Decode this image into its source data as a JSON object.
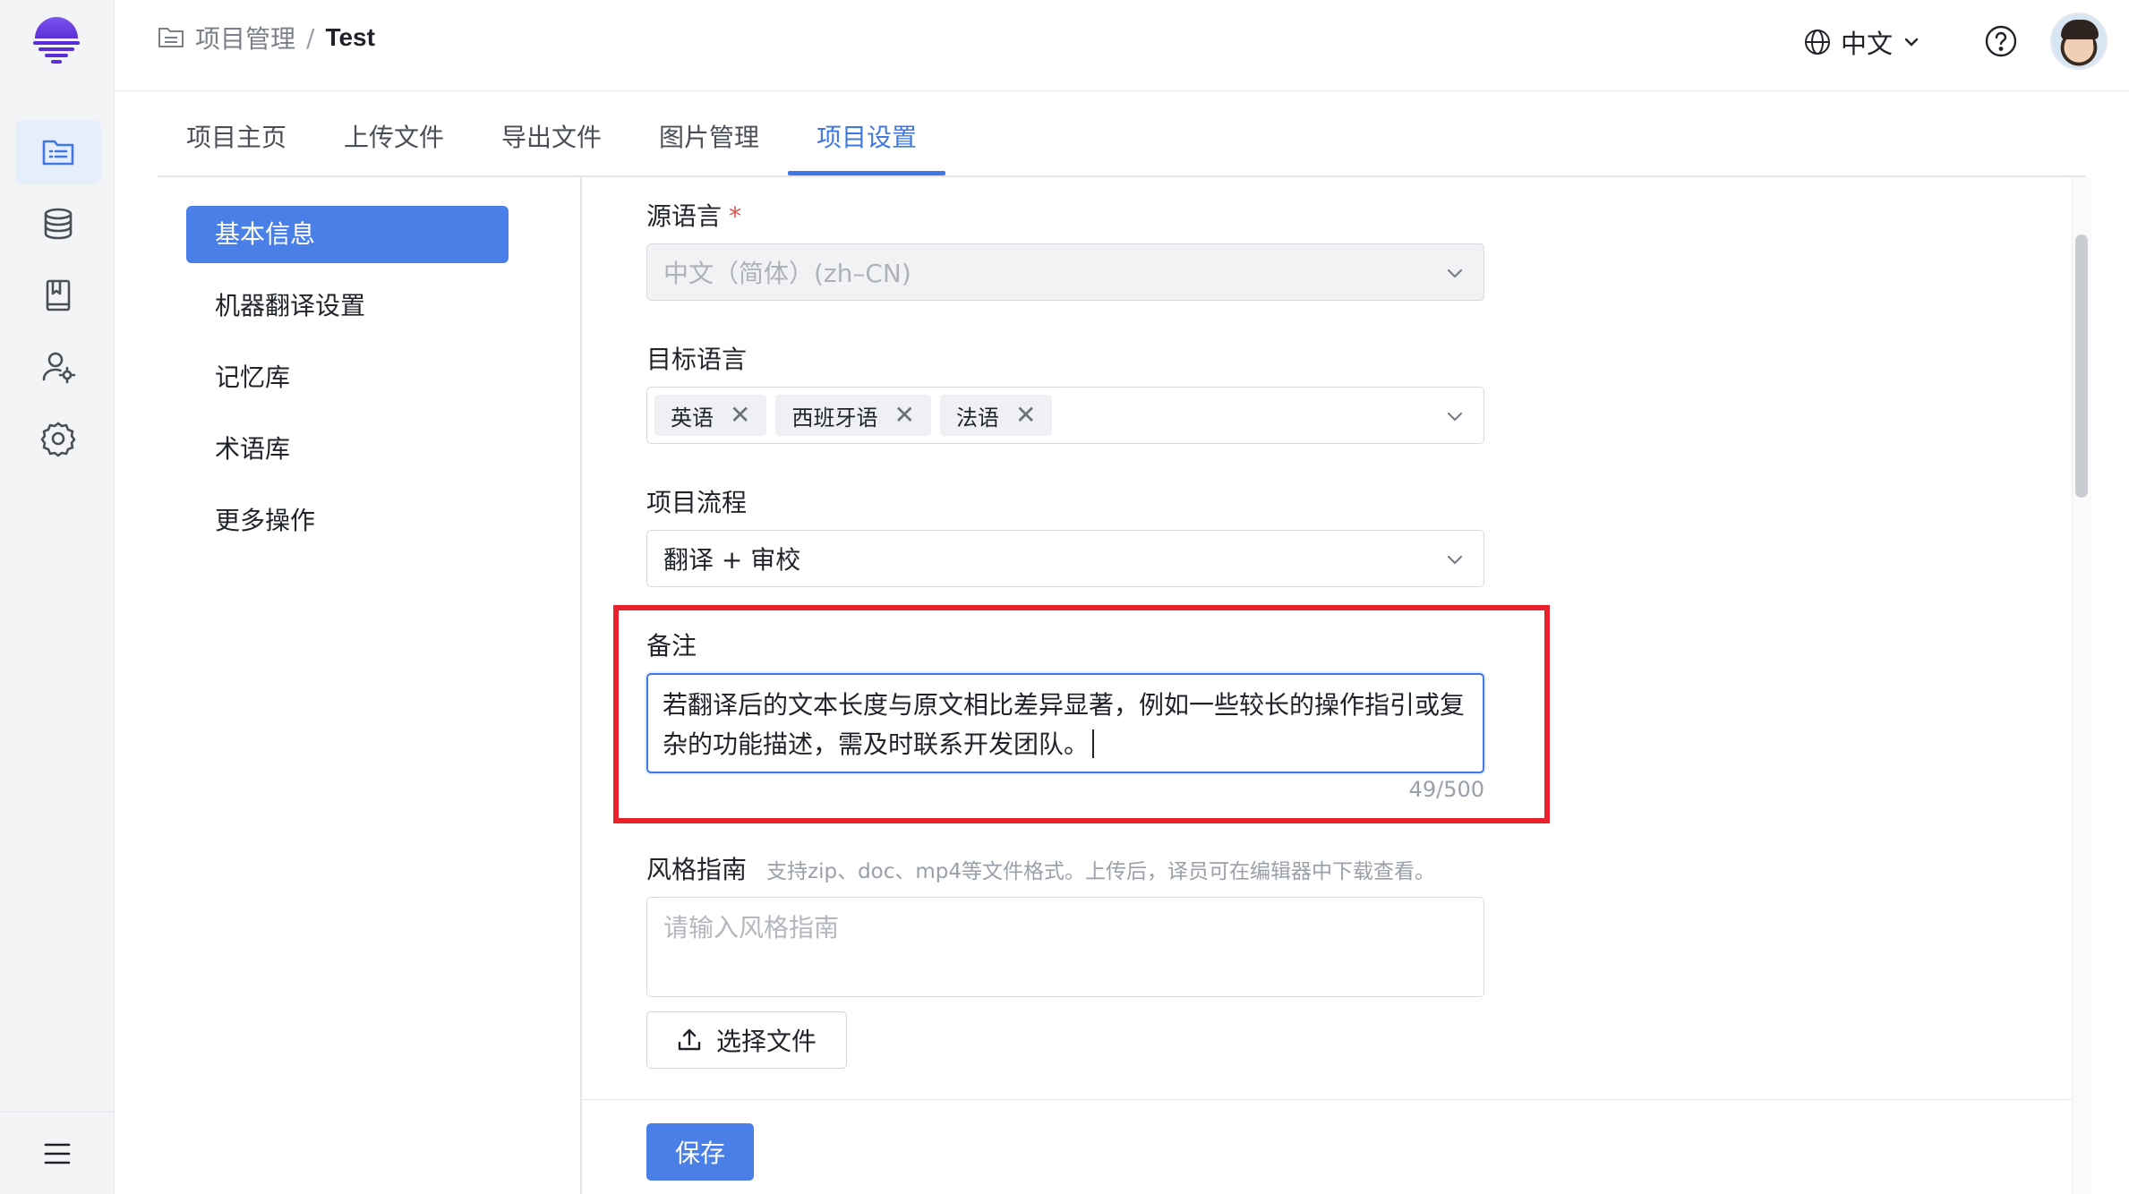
{
  "header": {
    "breadcrumb_parent": "项目管理",
    "breadcrumb_sep": "/",
    "breadcrumb_current": "Test",
    "language": "中文"
  },
  "tabs": [
    {
      "label": "项目主页"
    },
    {
      "label": "上传文件"
    },
    {
      "label": "导出文件"
    },
    {
      "label": "图片管理"
    },
    {
      "label": "项目设置",
      "active": true
    }
  ],
  "subnav": [
    {
      "label": "基本信息",
      "active": true
    },
    {
      "label": "机器翻译设置"
    },
    {
      "label": "记忆库"
    },
    {
      "label": "术语库"
    },
    {
      "label": "更多操作"
    }
  ],
  "form": {
    "source_language": {
      "label": "源语言",
      "required_mark": "*",
      "value": "中文（简体）(zh–CN)"
    },
    "target_language": {
      "label": "目标语言",
      "tags": [
        "英语",
        "西班牙语",
        "法语"
      ],
      "tag_remove": "✕"
    },
    "workflow": {
      "label": "项目流程",
      "value": "翻译 + 审校"
    },
    "notes": {
      "label": "备注",
      "value_line1": "若翻译后的文本长度与原文相比差异显著，例如一些较长的操作指引或复",
      "value_line2": "杂的功能描述，需及时联系开发团队。",
      "counter": "49/500"
    },
    "style_guide": {
      "label": "风格指南",
      "hint": "支持zip、doc、mp4等文件格式。上传后，译员可在编辑器中下载查看。",
      "placeholder": "请输入风格指南",
      "upload_label": "选择文件"
    }
  },
  "footer": {
    "save_label": "保存"
  },
  "colors": {
    "accent": "#3f78e6",
    "highlight": "#e8212a",
    "rail_bg": "#f3f4f6"
  },
  "icons": {
    "rail": [
      "project-list-icon",
      "database-icon",
      "book-icon",
      "user-settings-icon",
      "gear-icon"
    ],
    "header": [
      "globe-icon",
      "chevron-down-icon",
      "help-icon"
    ]
  }
}
